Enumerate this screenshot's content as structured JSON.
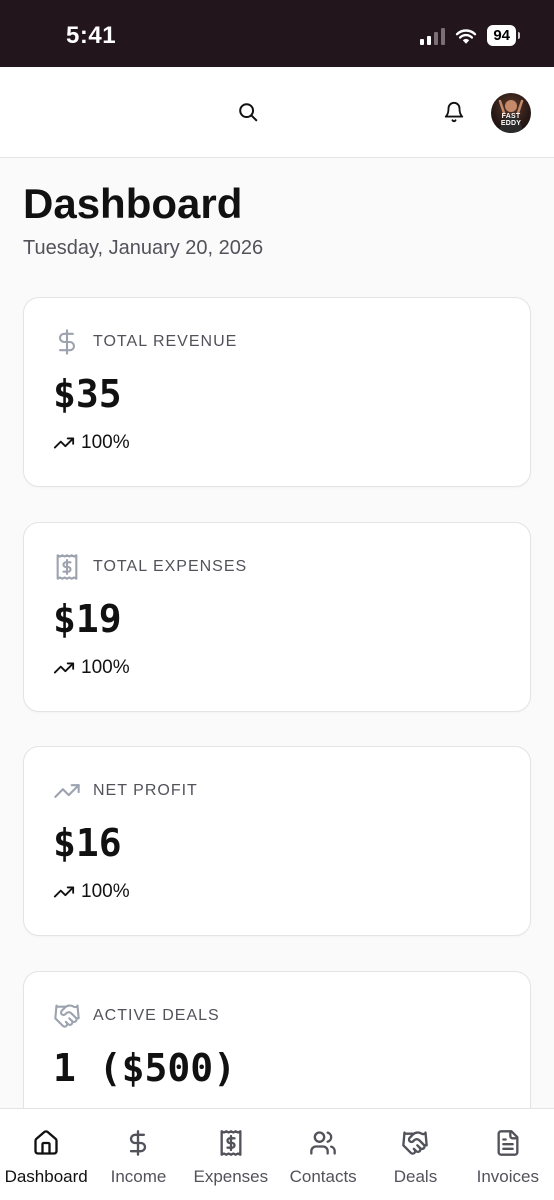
{
  "status_bar": {
    "time": "5:41",
    "battery": "94"
  },
  "header": {
    "avatar_text": "FAST EDDY"
  },
  "page": {
    "title": "Dashboard",
    "date": "Tuesday, January 20, 2026"
  },
  "cards": [
    {
      "label": "TOTAL REVENUE",
      "value": "$35",
      "trend": "100%",
      "icon": "dollar-icon"
    },
    {
      "label": "TOTAL EXPENSES",
      "value": "$19",
      "trend": "100%",
      "icon": "receipt-icon"
    },
    {
      "label": "NET PROFIT",
      "value": "$16",
      "trend": "100%",
      "icon": "trending-up-icon"
    },
    {
      "label": "ACTIVE DEALS",
      "value": "1 ($500)",
      "icon": "handshake-icon"
    }
  ],
  "nav": [
    {
      "label": "Dashboard",
      "icon": "home-icon",
      "active": true
    },
    {
      "label": "Income",
      "icon": "dollar-icon"
    },
    {
      "label": "Expenses",
      "icon": "receipt-icon"
    },
    {
      "label": "Contacts",
      "icon": "users-icon"
    },
    {
      "label": "Deals",
      "icon": "handshake-icon"
    },
    {
      "label": "Invoices",
      "icon": "document-icon"
    }
  ],
  "colors": {
    "status_bar": "#22151c",
    "text": "#171717",
    "muted": "#52525b",
    "border": "#e4e4e7",
    "background": "#fafafa"
  }
}
